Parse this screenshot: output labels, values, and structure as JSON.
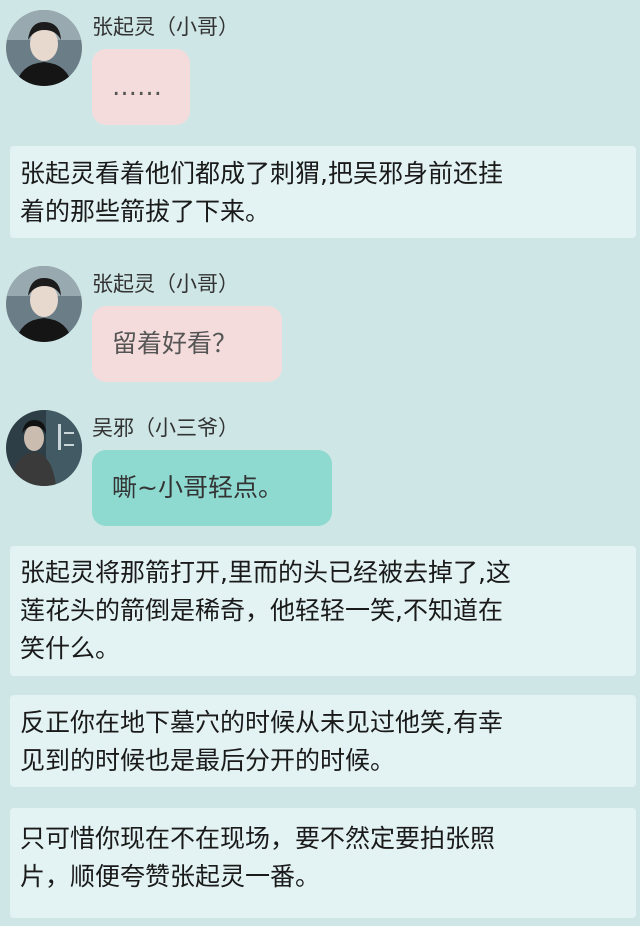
{
  "messages": [
    {
      "sender": "张起灵（小哥）",
      "text": "……",
      "style": "pink",
      "avatar": "avatar-zhang-qiling"
    },
    {
      "sender": "张起灵（小哥）",
      "text": "留着好看？",
      "style": "pink",
      "avatar": "avatar-zhang-qiling"
    },
    {
      "sender": "吴邪（小三爷）",
      "text": "嘶~小哥轻点。",
      "style": "teal",
      "avatar": "avatar-wu-xie"
    }
  ],
  "narrations": [
    {
      "lines": [
        "张起灵看着他们都成了刺猬,把吴邪身前还挂",
        "着的那些箭拔了下来。"
      ]
    },
    {
      "lines": [
        "张起灵将那箭打开,里而的头已经被去掉了,这",
        "莲花头的箭倒是稀奇，他轻轻一笑,不知道在",
        "笑什么。"
      ]
    },
    {
      "lines": [
        "反正你在地下墓穴的时候从未见过他笑,有幸",
        "见到的时候也是最后分开的时候。"
      ]
    },
    {
      "lines": [
        "只可惜你现在不在现场，要不然定要拍张照",
        "片，顺便夸赞张起灵一番。"
      ]
    }
  ],
  "colors": {
    "background": "#cfe6e6",
    "narration_bg": "#e3f3f3",
    "bubble_pink": "#f4dcdc",
    "bubble_teal": "#8ed9d0"
  }
}
